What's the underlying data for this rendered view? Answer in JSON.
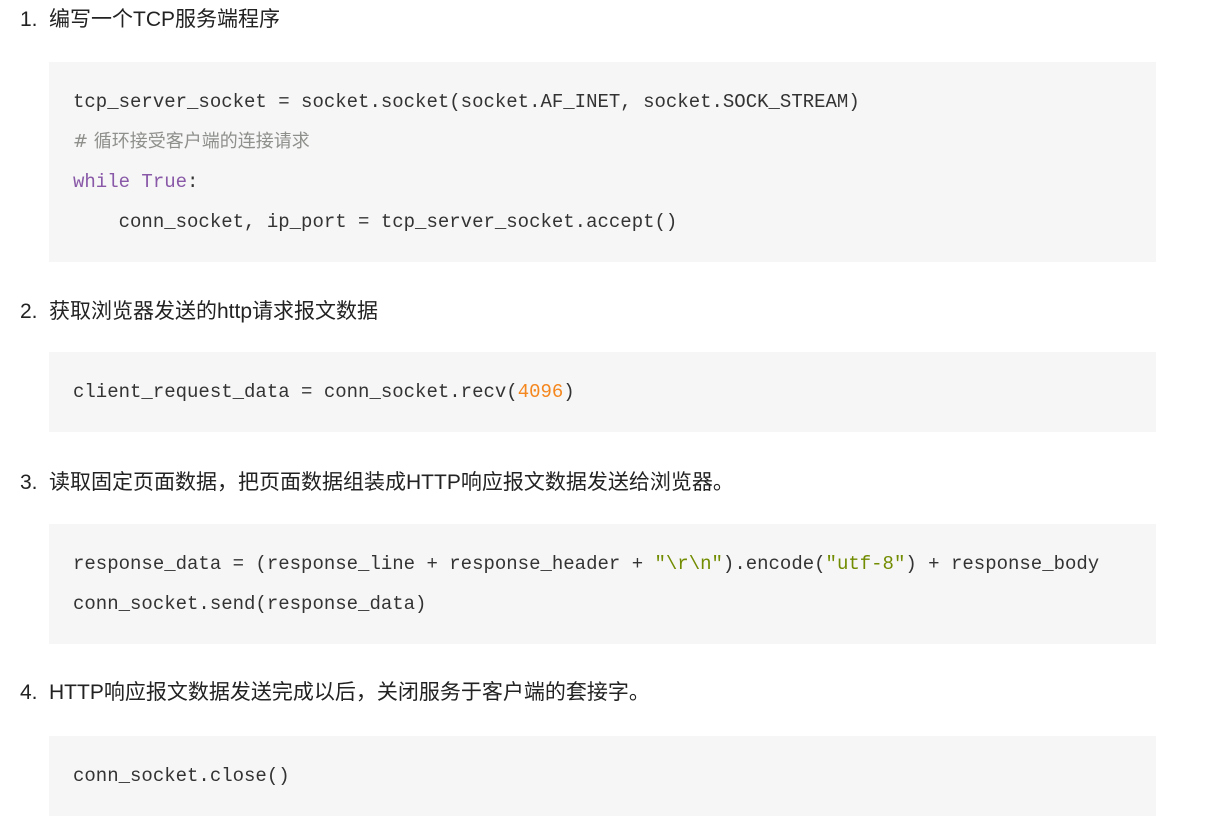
{
  "steps": [
    {
      "num": "1.",
      "title": "编写一个TCP服务端程序",
      "code": [
        [
          {
            "t": "tcp_server_socket = socket.socket(socket.AF_INET, socket.SOCK_STREAM)",
            "c": ""
          }
        ],
        [
          {
            "t": "# 循环接受客户端的连接请求",
            "c": "cm"
          }
        ],
        [
          {
            "t": "while",
            "c": "kw"
          },
          {
            "t": " ",
            "c": ""
          },
          {
            "t": "True",
            "c": "kw"
          },
          {
            "t": ":",
            "c": ""
          }
        ],
        [
          {
            "t": "    conn_socket, ip_port = tcp_server_socket.accept()",
            "c": ""
          }
        ]
      ]
    },
    {
      "num": "2.",
      "title": "获取浏览器发送的http请求报文数据",
      "code": [
        [
          {
            "t": "client_request_data = conn_socket.recv(",
            "c": ""
          },
          {
            "t": "4096",
            "c": "num-lit"
          },
          {
            "t": ")",
            "c": ""
          }
        ]
      ]
    },
    {
      "num": "3.",
      "title": "读取固定页面数据，把页面数据组装成HTTP响应报文数据发送给浏览器。",
      "code": [
        [
          {
            "t": "response_data = (response_line + response_header + ",
            "c": ""
          },
          {
            "t": "\"\\r\\n\"",
            "c": "str"
          },
          {
            "t": ").encode(",
            "c": ""
          },
          {
            "t": "\"utf-8\"",
            "c": "str"
          },
          {
            "t": ") + response_body",
            "c": ""
          }
        ],
        [
          {
            "t": "conn_socket.send(response_data)",
            "c": ""
          }
        ]
      ]
    },
    {
      "num": "4.",
      "title": "HTTP响应报文数据发送完成以后，关闭服务于客户端的套接字。",
      "code": [
        [
          {
            "t": "conn_socket.close()",
            "c": ""
          }
        ]
      ]
    }
  ],
  "colors": {
    "keyword": "#8959a8",
    "comment": "#8e908c",
    "number": "#f5871f",
    "string": "#718c00",
    "code_bg": "#f6f6f6"
  }
}
